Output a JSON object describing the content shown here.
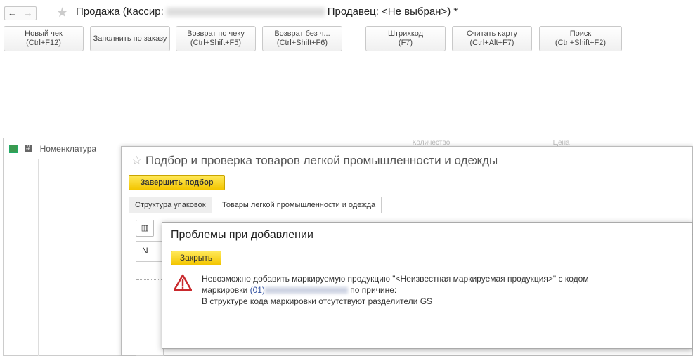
{
  "header": {
    "back": "←",
    "forward": "→",
    "title_prefix": "Продажа (Кассир:",
    "title_suffix": "Продавец: <Не выбран>) *"
  },
  "toolbar": [
    {
      "l1": "Новый чек",
      "l2": "(Ctrl+F12)"
    },
    {
      "l1": "Заполнить по заказу",
      "l2": ""
    },
    {
      "l1": "Возврат по чеку",
      "l2": "(Ctrl+Shift+F5)"
    },
    {
      "l1": "Возврат без ч...",
      "l2": "(Ctrl+Shift+F6)"
    },
    {
      "l1": "Штрихкод",
      "l2": "(F7)"
    },
    {
      "l1": "Считать карту",
      "l2": "(Ctrl+Alt+F7)"
    },
    {
      "l1": "Поиск",
      "l2": "(Ctrl+Shift+F2)"
    }
  ],
  "grid": {
    "col_num": "#",
    "col_name": "Номенклатура",
    "col_qty": "Количество",
    "col_price": "Цена"
  },
  "selection_dialog": {
    "title": "Подбор и проверка товаров легкой промышленности и одежды",
    "finish": "Завершить подбор",
    "tabs": [
      "Структура упаковок",
      "Товары легкой промышленности и одежда"
    ],
    "col_n": "N"
  },
  "problem_dialog": {
    "title": "Проблемы при добавлении",
    "close": "Закрыть",
    "msg1": "Невозможно добавить маркируемую продукцию \"<Неизвестная маркируемая продукция>\" с кодом",
    "msg2_prefix": "маркировки",
    "code_link": "(01)",
    "msg2_suffix": "по причине:",
    "msg3": "В структуре кода маркировки отсутствуют разделители GS"
  }
}
